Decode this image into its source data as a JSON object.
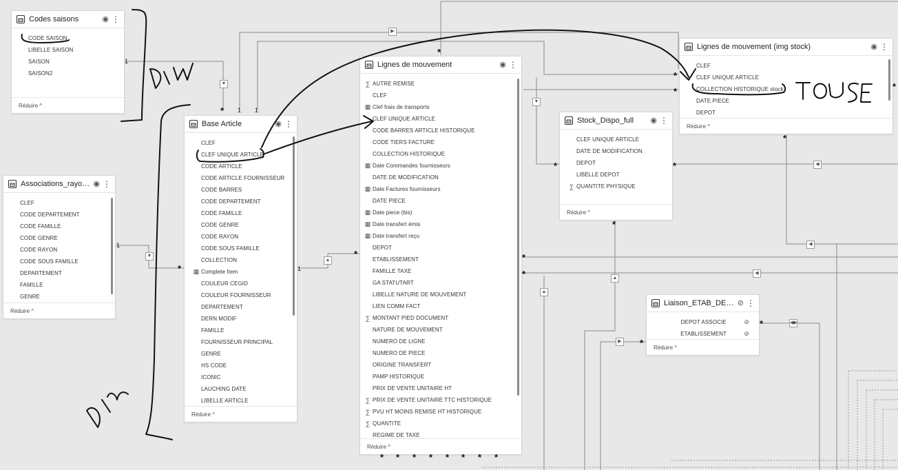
{
  "tables": {
    "codes_saisons": {
      "title": "Codes saisons",
      "fields": [
        "CODE SAISON",
        "LIBELLE SAISON",
        "SAISON",
        "SAISON2"
      ],
      "footer": "Réduire ^"
    },
    "associations": {
      "title": "Associations_rayons_f...",
      "fields": [
        "CLEF",
        "CODE DEPARTEMENT",
        "CODE FAMILLE",
        "CODE GENRE",
        "CODE RAYON",
        "CODE SOUS FAMILLE",
        "DEPARTEMENT",
        "FAMILLE",
        "GENRE"
      ],
      "footer": "Réduire ^"
    },
    "base_article": {
      "title": "Base Article",
      "fields": [
        "CLEF",
        "CLEF UNIQUE ARTICLE",
        "CODE ARTICLE",
        "CODE ARTICLE FOURNISSEUR",
        "CODE BARRES",
        "CODE DEPARTEMENT",
        "CODE FAMILLE",
        "CODE GENRE",
        "CODE RAYON",
        "CODE SOUS FAMILLE",
        "COLLECTION",
        "Complete Item",
        "COULEUR CEGID",
        "COULEUR FOURNISSEUR",
        "DEPARTEMENT",
        "DERN MODIF",
        "FAMILLE",
        "FOURNISSEUR PRINCIPAL",
        "GENRE",
        "HS CODE",
        "ICONIC",
        "LAUCHING DATE",
        "LIBELLE ARTICLE"
      ],
      "footer": "Réduire ^"
    },
    "lignes_mouvement": {
      "title": "Lignes de mouvement",
      "fields": [
        "AUTRE REMISE",
        "CLEF",
        "Clef frais de transports",
        "CLEF UNIQUE ARTICLE",
        "CODE BARRES ARTICLE HISTORIQUE",
        "CODE TIERS FACTURE",
        "COLLECTION HISTORIQUE",
        "Date Commandes fournisseurs",
        "DATE DE MODIFICATION",
        "Date Factures fournisseurs",
        "DATE PIECE",
        "Date piece (bis)",
        "Date transfert émis",
        "Date transfert reçu",
        "DEPOT",
        "ETABLISSEMENT",
        "FAMILLE TAXE",
        "GA STATUTART",
        "LIBELLE NATURE DE MOUVEMENT",
        "LIEN COMM FACT",
        "MONTANT PIED DOCUMENT",
        "NATURE DE MOUVEMENT",
        "NUMERO DE LIGNE",
        "NUMERO DE PIECE",
        "ORIGINE TRANSFERT",
        "PAMP HISTORIQUE",
        "PRIX DE VENTE UNITAIRE HT",
        "PRIX DE VENTE UNITAIRE TTC HISTORIQUE",
        "PVU HT MOINS REMISE HT HISTORIQUE",
        "QUANTITE",
        "REGIME DE TAXE"
      ],
      "icons": [
        "sigma",
        "",
        "calc",
        "",
        "",
        "",
        "",
        "calc",
        "",
        "calc",
        "",
        "calc",
        "calc",
        "calc",
        "",
        "",
        "",
        "",
        "",
        "",
        "sigma",
        "",
        "",
        "",
        "",
        "",
        "",
        "sigma",
        "sigma",
        "sigma",
        ""
      ],
      "footer": "Réduire ^"
    },
    "stock_dispo": {
      "title": "Stock_Dispo_full",
      "fields": [
        "CLEF UNIQUE ARTICLE",
        "DATE DE MODIFICATION",
        "DEPOT",
        "LIBELLE DEPOT",
        "QUANTITE PHYSIQUE"
      ],
      "footer": "Réduire ^"
    },
    "lignes_img_stock": {
      "title": "Lignes de mouvement (img stock)",
      "fields": [
        "CLEF",
        "CLEF UNIQUE ARTICLE",
        "COLLECTION HISTORIQUE stock",
        "DATE PIECE",
        "DEPOT"
      ],
      "footer": "Réduire ^"
    },
    "liaison": {
      "title": "Liaison_ETAB_DEPOT",
      "fields": [
        "DEPOT ASSOCIE",
        "ETABLISSEMENT"
      ],
      "footer": "Réduire ^"
    }
  },
  "cardinality": {
    "one": "1",
    "many": "*"
  },
  "annotations": {
    "dim_top": "DIM",
    "dim_bottom": "DIM",
    "to_use": "TO USE"
  },
  "colors": {
    "canvas": "#e8e8e8",
    "line": "#7a7a7a",
    "ink": "#111111"
  }
}
